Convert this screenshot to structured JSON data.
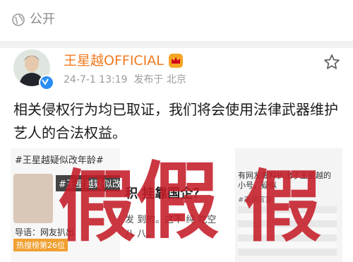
{
  "header": {
    "visibility": "公开",
    "globe_icon": "globe-icon"
  },
  "post": {
    "author": "王星越OFFICIAL",
    "crown_icon": "crown-badge-icon",
    "verified_icon": "verified-v-icon",
    "time": "24-7-1 13:19",
    "location": "发布于 北京",
    "text": "相关侵权行为均已取证，我们将会使用法律武器维护艺人的合法权益。"
  },
  "images": [
    {
      "hashtag": "#王星越疑似改年龄#",
      "hashtag_banner": "#王星越疑似改年",
      "caption": "导语：网友扒出",
      "badge": "热搜榜第26位"
    },
    {
      "headline": "积 挂靠国企？",
      "line1": "发 到的。这不 纯 吃空",
      "line2": "八 八。"
    },
    {
      "line1": "有网友爆料扒出了王星越的 小号，疑似",
      "line2": "#高调官宣"
    }
  ],
  "overlay": {
    "stamp": "假"
  },
  "colors": {
    "username": "#f07a20",
    "verified": "#2a8df4",
    "stamp": "#c41c28",
    "meta": "#9a9a9a"
  }
}
